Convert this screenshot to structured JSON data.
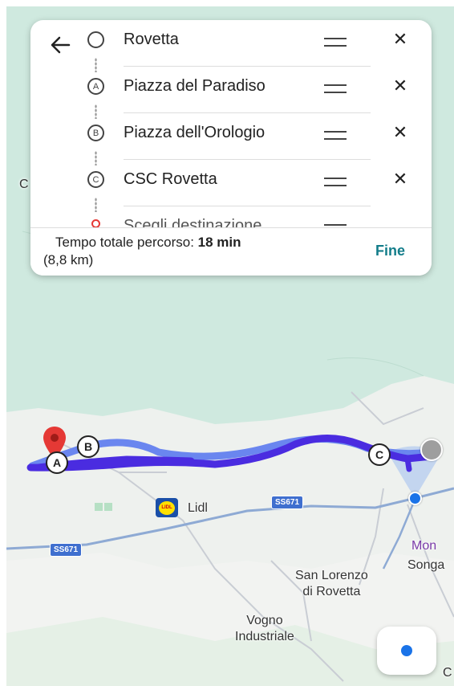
{
  "directions": {
    "back_label": "Back",
    "stops": [
      {
        "marker": "",
        "name": "Rovetta",
        "kind": "origin"
      },
      {
        "marker": "A",
        "name": "Piazza del Paradiso",
        "kind": "waypoint"
      },
      {
        "marker": "B",
        "name": "Piazza dell'Orologio",
        "kind": "waypoint"
      },
      {
        "marker": "C",
        "name": "CSC Rovetta",
        "kind": "waypoint"
      },
      {
        "marker": "",
        "name": "Scegli destinazione",
        "kind": "destination"
      }
    ],
    "total_time_label": "Tempo totale percorso:",
    "total_time_value": "18 min",
    "total_distance": "(8,8 km)",
    "done_label": "Fine"
  },
  "map": {
    "labels": {
      "lidl": "Lidl",
      "road_top": "SS671",
      "road_left": "SS671",
      "san_lorenzo": "San Lorenzo\ndi Rovetta",
      "vogno": "Vogno\nIndustriale",
      "mon": "Mon",
      "songa": "Songa",
      "edge_c_left": "C",
      "edge_c_bottom": "C"
    },
    "markers": [
      "A",
      "B",
      "C"
    ],
    "colors": {
      "route": "#4a2ce0",
      "route_alt": "#6a86ef",
      "map_bg": "#cfe9df",
      "done_text": "#137d8a",
      "pin": "#e53935",
      "location": "#1a73e8"
    }
  }
}
